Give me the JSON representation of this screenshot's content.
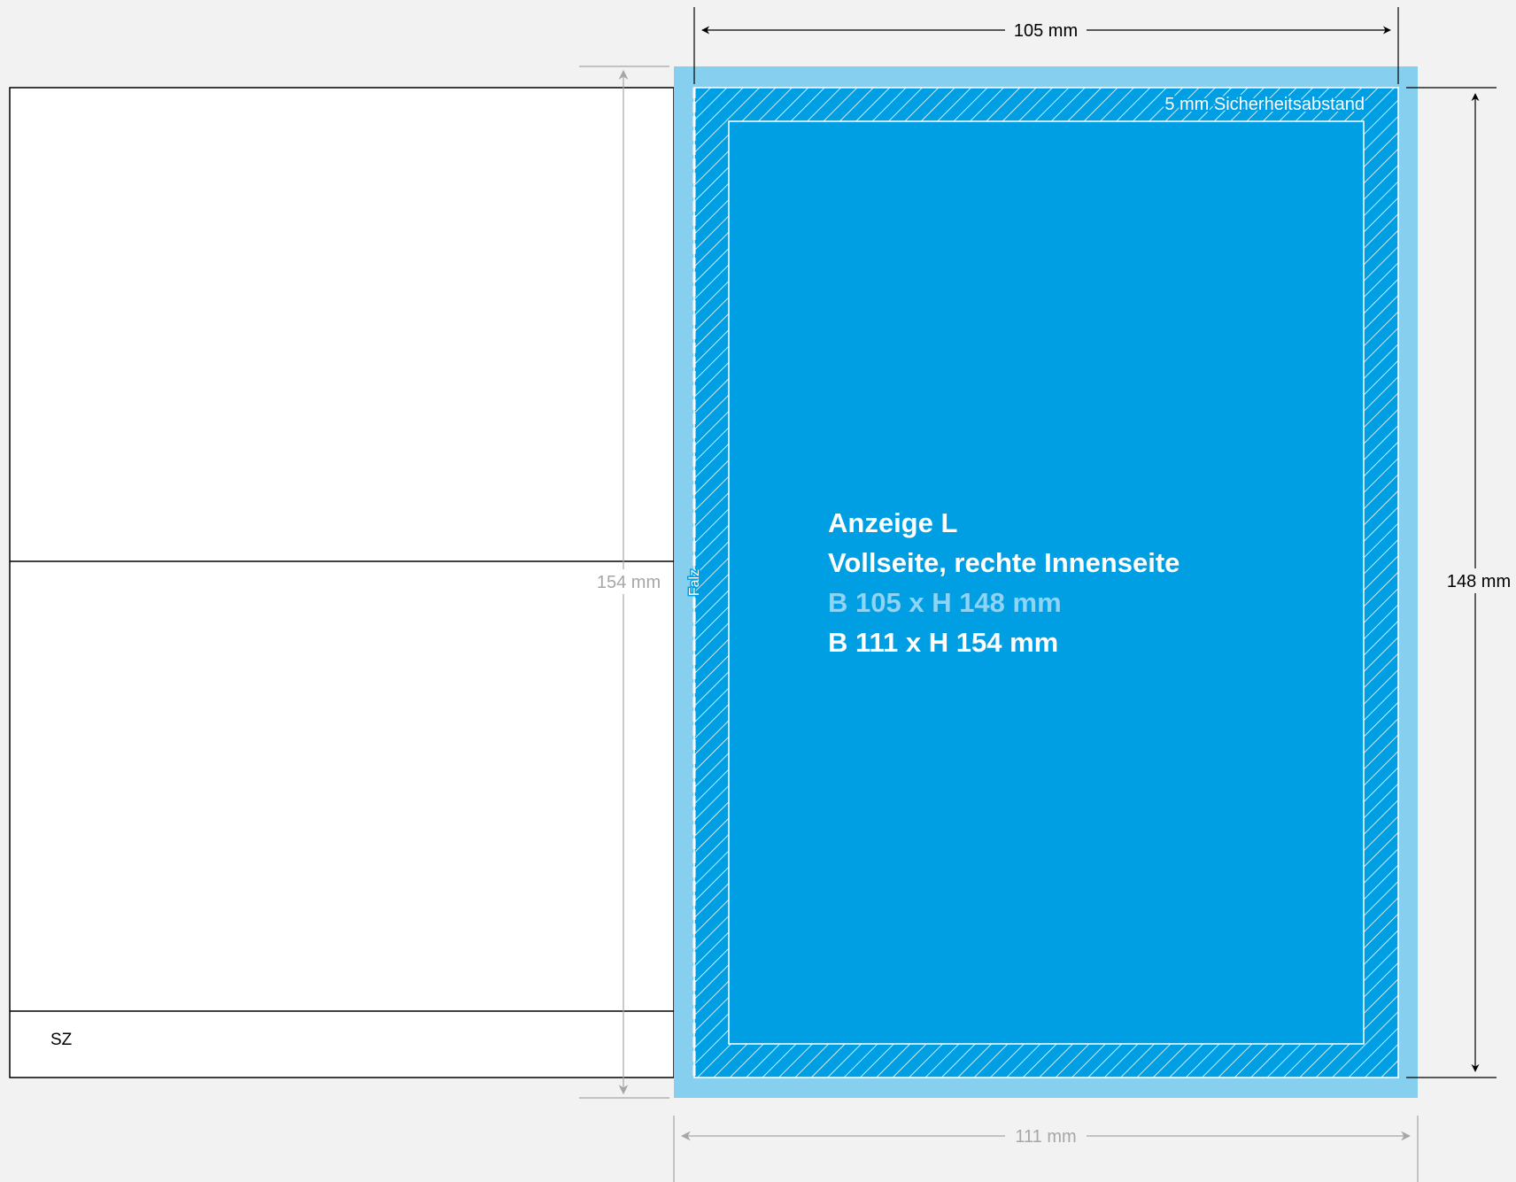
{
  "labels": {
    "width_trim": "105 mm",
    "height_trim": "148 mm",
    "height_bleed": "154 mm",
    "width_bleed": "111 mm",
    "safety_margin": "5 mm Sicherheitsabstand",
    "fold": "Falz",
    "left_page_tag": "SZ"
  },
  "ad": {
    "title": "Anzeige L",
    "subtitle": "Vollseite, rechte Innenseite",
    "trim_size": "B 105 x H 148 mm",
    "bleed_size": "B 111 x H 154 mm"
  },
  "colors": {
    "background": "#f2f2f2",
    "ad_fill": "#009fe3",
    "bleed": "#87cfef",
    "trim_size_text": "#8fd3f5",
    "guide_gray": "#a6a6a6",
    "line_black": "#000000"
  }
}
